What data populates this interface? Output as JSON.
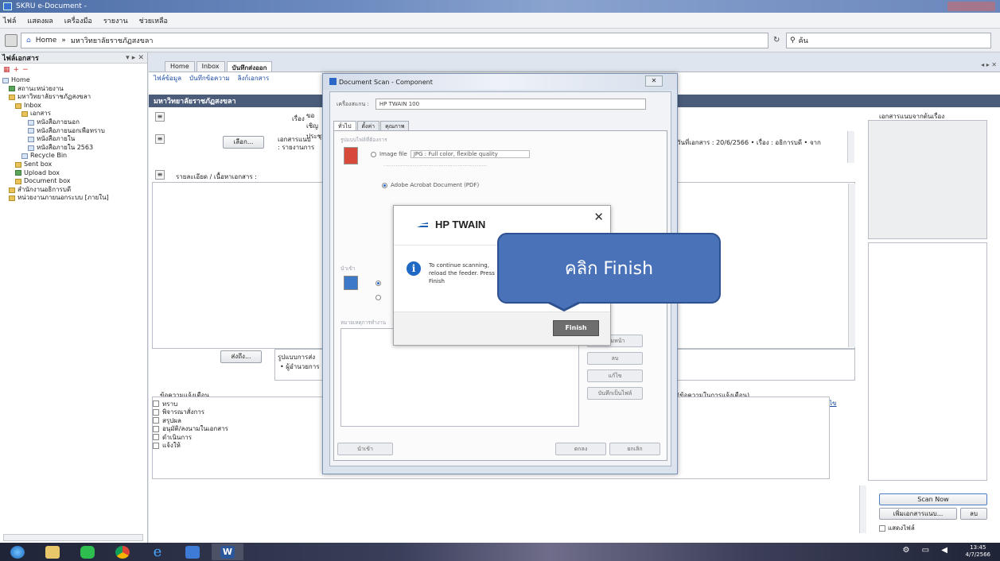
{
  "window": {
    "title": "SKRU e-Document - ",
    "colors": {
      "header_bar": "#4b5c7b",
      "callout": "#4a72b8",
      "finish_button": "#6e6e6e"
    }
  },
  "menu": [
    "ไฟล์",
    "แสดงผล",
    "เครื่องมือ",
    "รายงาน",
    "ช่วยเหลือ"
  ],
  "address": {
    "path_home": "Home",
    "path_sep": "»",
    "path_current": "มหาวิทยาลัยราชภัฏสงขลา",
    "search_value": "ค้น"
  },
  "left_panel": {
    "title": "ไฟล์เอกสาร",
    "controls": "▾ ▸ ✕",
    "tree": [
      {
        "label": "Home",
        "indent": 0,
        "icon": "doc"
      },
      {
        "label": "สถานะหน่วยงาน",
        "indent": 1,
        "icon": "green"
      },
      {
        "label": "มหาวิทยาลัยราชภัฏสงขลา",
        "indent": 1,
        "icon": "folder"
      },
      {
        "label": "Inbox",
        "indent": 2,
        "icon": "folder"
      },
      {
        "label": "เอกสาร",
        "indent": 3,
        "icon": "folder"
      },
      {
        "label": "หนังสือภายนอก",
        "indent": 4,
        "icon": "doc"
      },
      {
        "label": "หนังสือภายนอกเพื่อทราบ",
        "indent": 4,
        "icon": "doc"
      },
      {
        "label": "หนังสือภายใน",
        "indent": 4,
        "icon": "doc"
      },
      {
        "label": "หนังสือภายใน 2563",
        "indent": 4,
        "icon": "doc"
      },
      {
        "label": "Recycle Bin",
        "indent": 3,
        "icon": "doc"
      },
      {
        "label": "Sent box",
        "indent": 2,
        "icon": "folder"
      },
      {
        "label": "Upload box",
        "indent": 2,
        "icon": "green"
      },
      {
        "label": "Document box",
        "indent": 2,
        "icon": "folder"
      },
      {
        "label": "สำนักงานอธิการบดี",
        "indent": 1,
        "icon": "folder"
      },
      {
        "label": "หน่วยงานภายนอกระบบ [ภายใน]",
        "indent": 1,
        "icon": "folder"
      }
    ]
  },
  "tabs": [
    "Home",
    "Inbox",
    "บันทึกส่งออก"
  ],
  "content": {
    "links": [
      "ไฟล์ข้อมูล",
      "บันทึกข้อความ",
      "ลิงก์เอกสาร"
    ],
    "header": "มหาวิทยาลัยราชภัฏสงขลา",
    "subject_label": "เรื่อง :",
    "subject_value": "ขอเชิญประชุม",
    "attach_button": "เลือก...",
    "attach_text": "เอกสารแนบ",
    "attach_text2": ": รายงานการ",
    "desc_label": "รายละเอียด / เนื้อหาเอกสาร :",
    "info_line": "วันที่เอกสาร : 20/6/2566 • เรื่อง : อธิการบดี • จาก",
    "send_button": "ส่งถึง...",
    "send_text": "รูปแบบการส่ง",
    "send_text2": "• ผู้อำนวยการ",
    "notify_label": "ข้อความแจ้งเตือน",
    "notify_right": "(ข้อความในการแจ้งเตือน)",
    "edit_link": "แก้ไข",
    "checklist": [
      "ทราบ",
      "พิจารณาสั่งการ",
      "สรุปผล",
      "อนุมัติ/ลงนามในเอกสาร",
      "ดำเนินการ",
      "แจ้งให้"
    ],
    "right_title": "เอกสารแนบจากต้นเรื่อง",
    "scan_button": "Scan Now",
    "add_button": "เพิ่มเอกสารแนบ...",
    "delete_button": "ลบ",
    "show_file_label": "แสดงไฟล์"
  },
  "scan_dialog": {
    "title": "Document Scan - Component",
    "device_label": "เครื่องสแกน :",
    "device_value": "HP TWAIN 100",
    "tabs": [
      "ทั่วไป",
      "ตั้งค่า",
      "คุณภาพ"
    ],
    "format_label": "รูปแบบไฟล์ที่ต้องการ",
    "image_file": "Image file",
    "image_format": "JPG : Full color, flexible quality",
    "pdf_option": "Adobe Acrobat Document (PDF)",
    "scan_label": "นำเข้า",
    "notes_label": "หมายเหตุการทำงาน",
    "side_buttons": [
      "เพิ่มหน้า",
      "ลบ",
      "แก้ไข",
      "บันทึกเป็นไฟล์"
    ],
    "bottom_left": "นำเข้า",
    "ok_button": "ตกลง",
    "cancel_button": "ยกเลิก"
  },
  "hp_dialog": {
    "title": "HP TWAIN",
    "message": "To continue scanning, reload the feeder. Press Finish",
    "finish_button": "Finish"
  },
  "callout": {
    "text": "คลิก Finish"
  },
  "taskbar": {
    "apps": [
      "start-orb-icon",
      "file-explorer-icon",
      "line-app-icon",
      "chrome-icon",
      "internet-explorer-icon",
      "app-window-icon",
      "word-icon"
    ],
    "tray": "⚙ ▭ ◀",
    "time": "13:45",
    "date": "4/7/2566"
  }
}
